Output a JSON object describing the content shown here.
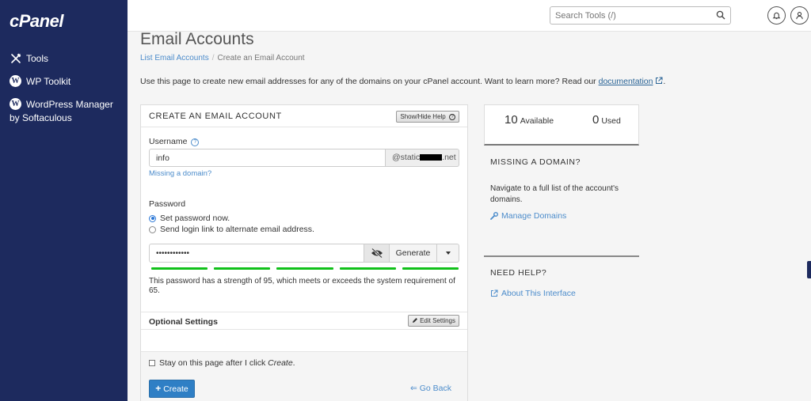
{
  "sidebar": {
    "logo": "cPanel",
    "items": [
      {
        "label": "Tools",
        "icon": "tools-icon"
      },
      {
        "label": "WP Toolkit",
        "icon": "wordpress-icon"
      },
      {
        "label": "WordPress Manager by Softaculous",
        "icon": "wordpress-icon"
      }
    ]
  },
  "topbar": {
    "search_placeholder": "Search Tools (/)"
  },
  "page": {
    "title": "Email Accounts",
    "breadcrumb": [
      "List Email Accounts",
      "Create an Email Account"
    ],
    "intro_text": "Use this page to create new email addresses for any of the domains on your cPanel account. Want to learn more? Read our",
    "intro_link": "documentation",
    "intro_tail": "."
  },
  "form": {
    "panel_title": "CREATE AN EMAIL ACCOUNT",
    "show_hide_help": "Show/Hide Help",
    "username_label": "Username",
    "username_value": "info",
    "domain_prefix": "@static",
    "domain_suffix": ".net",
    "missing_domain": "Missing a domain?",
    "password_label": "Password",
    "radio_set_now": "Set password now.",
    "radio_send_link": "Send login link to alternate email address.",
    "password_value": "••••••••••••",
    "generate": "Generate",
    "strength_text": "This password has a strength of 95, which meets or exceeds the system requirement of 65.",
    "strength_value": 95,
    "strength_required": 65,
    "optional_settings": "Optional Settings",
    "edit_settings": "Edit Settings",
    "stay_on_page_prefix": "Stay on this page after I click ",
    "stay_on_page_em": "Create",
    "stay_on_page_suffix": ".",
    "create_button": "Create",
    "go_back": "Go Back"
  },
  "stats": {
    "available_num": "10",
    "available_label": "Available",
    "used_num": "0",
    "used_label": "Used"
  },
  "side": {
    "missing_heading": "MISSING A DOMAIN?",
    "missing_text": "Navigate to a full list of the account's domains.",
    "manage_domains": "Manage Domains",
    "help_heading": "NEED HELP?",
    "about_link": "About This Interface"
  },
  "colors": {
    "sidebar_bg": "#1d2a5e",
    "accent": "#4c8ccb",
    "primary_button": "#2f7fc5",
    "strength_bar": "#11c11a"
  }
}
